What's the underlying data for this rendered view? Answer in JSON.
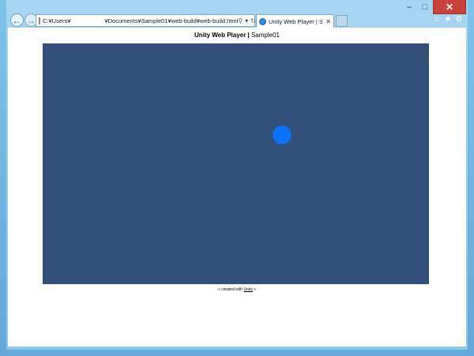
{
  "window": {
    "caption_buttons": {
      "minimize": "–",
      "maximize": "□",
      "close": "✕"
    }
  },
  "toolbar": {
    "back_icon": "←",
    "forward_icon": "→",
    "address_part1": "C:¥Users¥",
    "address_part2": "¥Documents¥Sample01¥web-build¥web-build.html",
    "search_icon": "⚲",
    "dropdown_icon": "▾",
    "refresh_icon": "↻",
    "tab_label": "Unity Web Player | Sam...",
    "tab_close": "✕",
    "home_icon": "⌂",
    "favorites_icon": "★",
    "tools_icon": "⚙"
  },
  "page": {
    "heading_bold": "Unity Web Player",
    "heading_sep": " | ",
    "heading_title": "Sample01",
    "footer_prefix": "« created with ",
    "footer_link": "Unity",
    "footer_suffix": " »"
  },
  "colors": {
    "player_background": "#325079",
    "sphere": "#0a72f4"
  }
}
